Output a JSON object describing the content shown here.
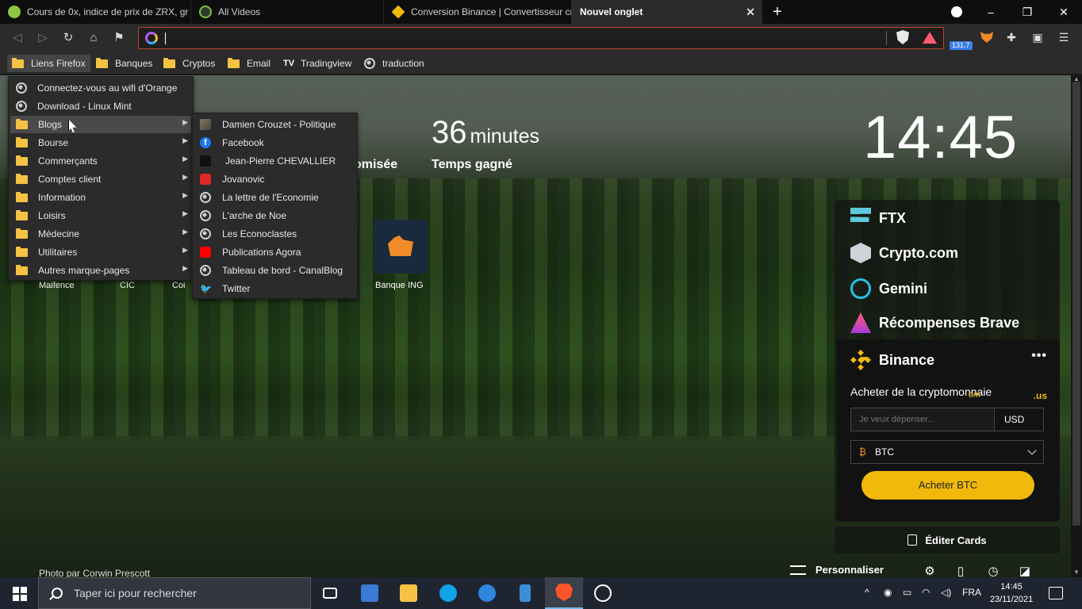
{
  "tabs": [
    {
      "label": "Cours de 0x, indice de prix de ZRX, gr",
      "icon": "coingecko-icon",
      "active": false
    },
    {
      "label": "All Videos",
      "icon": "play-icon",
      "active": false
    },
    {
      "label": "Conversion Binance | Convertisseur cr",
      "icon": "binance-icon",
      "active": false
    },
    {
      "label": "Nouvel onglet",
      "icon": "",
      "active": true
    }
  ],
  "window": {
    "minimize": "–",
    "maximize": "❐",
    "close": "✕",
    "new_tab": "+"
  },
  "navbar": {
    "back": "◁",
    "forward": "▷",
    "reload": "↻",
    "home": "⌂",
    "bookmark": "⚑",
    "url_value": "",
    "rewards_badge": "131.7",
    "menu": "☰"
  },
  "bookmarks_bar": [
    {
      "label": "Liens Firefox",
      "type": "folder"
    },
    {
      "label": "Banques",
      "type": "folder"
    },
    {
      "label": "Cryptos",
      "type": "folder"
    },
    {
      "label": "Email",
      "type": "folder"
    },
    {
      "label": "Tradingview",
      "type": "tradingview"
    },
    {
      "label": "traduction",
      "type": "globe"
    }
  ],
  "menu_firefox": [
    {
      "label": "Connectez-vous au wifi d'Orange",
      "type": "globe"
    },
    {
      "label": "Download - Linux Mint",
      "type": "globe"
    },
    {
      "label": "Blogs",
      "type": "folder",
      "submenu": true,
      "hover": true
    },
    {
      "label": "Bourse",
      "type": "folder",
      "submenu": true
    },
    {
      "label": "Commerçants",
      "type": "folder",
      "submenu": true
    },
    {
      "label": "Comptes client",
      "type": "folder",
      "submenu": true
    },
    {
      "label": "Information",
      "type": "folder",
      "submenu": true
    },
    {
      "label": "Loisirs",
      "type": "folder",
      "submenu": true
    },
    {
      "label": "Médecine",
      "type": "folder",
      "submenu": true
    },
    {
      "label": "Utilitaires",
      "type": "folder",
      "submenu": true
    },
    {
      "label": "Autres marque-pages",
      "type": "folder",
      "submenu": true
    }
  ],
  "menu_blogs": [
    {
      "label": "Damien Crouzet - Politique",
      "icon": "image-favicon"
    },
    {
      "label": "Facebook",
      "icon": "facebook-icon"
    },
    {
      "label": "Jean-Pierre CHEVALLIER",
      "icon": "bookmark-favicon"
    },
    {
      "label": "Jovanovic",
      "icon": "heart-favicon"
    },
    {
      "label": "La lettre de l'Economie",
      "icon": "globe-icon"
    },
    {
      "label": "L'arche de Noe",
      "icon": "globe-icon"
    },
    {
      "label": "Les Econoclastes",
      "icon": "globe-icon"
    },
    {
      "label": "Publications Agora",
      "icon": "youtube-icon"
    },
    {
      "label": "Tableau de bord - CanalBlog",
      "icon": "globe-icon"
    },
    {
      "label": "Twitter",
      "icon": "twitter-icon"
    }
  ],
  "stats": {
    "left_label_partial": "omisée",
    "time_value": "36",
    "time_unit": "minutes",
    "time_label": "Temps gagné"
  },
  "clock": "14:45",
  "top_sites": [
    {
      "label": "Maifence"
    },
    {
      "label": "CIC"
    },
    {
      "label": "Coi"
    },
    {
      "label": "Banque ING"
    }
  ],
  "crypto_widgets": [
    {
      "label": "FTX",
      "icon": "ftx-icon"
    },
    {
      "label": "Crypto.com",
      "icon": "crypto-com-icon"
    },
    {
      "label": "Gemini",
      "icon": "gemini-icon"
    },
    {
      "label": "Récompenses Brave",
      "icon": "brave-rewards-icon"
    }
  ],
  "binance": {
    "title": "Binance",
    "menu": "•••",
    "buy_title": "Acheter de la cryptomonnaie",
    "tab_com": "om",
    "tab_us": ".us",
    "spend_placeholder": "Je veux dépenser...",
    "currency": "USD",
    "coin": "BTC",
    "coin_symbol": "₿",
    "buy_button": "Acheter BTC"
  },
  "edit_cards": "Éditer Cards",
  "photo_credit": "Photo par Corwin Prescott",
  "customize": "Personnaliser",
  "taskbar": {
    "search_placeholder": "Taper ici pour rechercher",
    "tray_lang": "FRA",
    "tray_up": "^",
    "time": "14:45",
    "date": "23/11/2021"
  },
  "colors": {
    "accent_binance": "#f0b90b",
    "url_border": "#c0462a",
    "taskbar": "#1f2530"
  }
}
